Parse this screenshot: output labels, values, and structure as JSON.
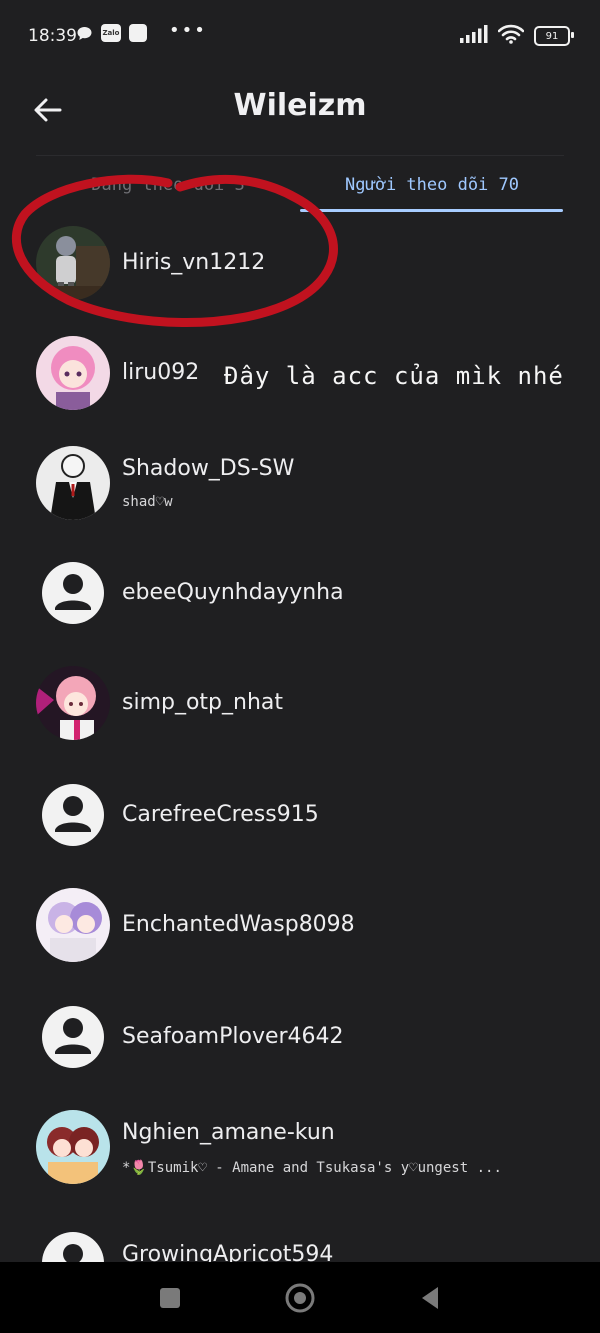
{
  "status_bar": {
    "time": "18:39",
    "zalo_label": "Zalo",
    "more": "•••",
    "battery": "91"
  },
  "header": {
    "title": "Wileizm"
  },
  "tabs": {
    "following": "Đang theo dõi 3",
    "followers": "Người theo dõi 70"
  },
  "annotation": {
    "text": "Đây là acc của mìk nhé",
    "circle_color": "#c1121f"
  },
  "users": [
    {
      "username": "Hiris_vn1212",
      "bio": "",
      "avatar": "photo"
    },
    {
      "username": "liru092",
      "bio": "",
      "avatar": "anime-pink"
    },
    {
      "username": "Shadow_DS-SW",
      "bio": "shad♡w",
      "avatar": "anime-suit"
    },
    {
      "username": "ebeeQuynhdayynha",
      "bio": "",
      "avatar": "default"
    },
    {
      "username": "simp_otp_nhat",
      "bio": "",
      "avatar": "anime-pink"
    },
    {
      "username": "CarefreeCress915",
      "bio": "",
      "avatar": "default"
    },
    {
      "username": "EnchantedWasp8098",
      "bio": "",
      "avatar": "anime-purple"
    },
    {
      "username": "SeafoamPlover4642",
      "bio": "",
      "avatar": "default"
    },
    {
      "username": "Nghien_amane-kun",
      "bio": "*🌷Tsumik♡ - Amane and Tsukasa's y♡ungest ...",
      "avatar": "anime-red"
    },
    {
      "username": "GrowingApricot594",
      "bio": "",
      "avatar": "default"
    }
  ],
  "colors": {
    "background": "#1f1f21",
    "accent": "#a7ccff",
    "annotation": "#c1121f"
  }
}
